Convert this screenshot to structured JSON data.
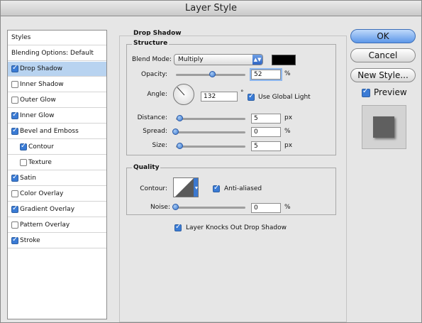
{
  "window": {
    "title": "Layer Style"
  },
  "sidebar": {
    "header": "Styles",
    "blending": "Blending Options: Default",
    "items": [
      {
        "label": "Drop Shadow",
        "checked": true,
        "selected": true,
        "indent": false
      },
      {
        "label": "Inner Shadow",
        "checked": false,
        "selected": false,
        "indent": false
      },
      {
        "label": "Outer Glow",
        "checked": false,
        "selected": false,
        "indent": false
      },
      {
        "label": "Inner Glow",
        "checked": true,
        "selected": false,
        "indent": false
      },
      {
        "label": "Bevel and Emboss",
        "checked": true,
        "selected": false,
        "indent": false
      },
      {
        "label": "Contour",
        "checked": true,
        "selected": false,
        "indent": true
      },
      {
        "label": "Texture",
        "checked": false,
        "selected": false,
        "indent": true
      },
      {
        "label": "Satin",
        "checked": true,
        "selected": false,
        "indent": false
      },
      {
        "label": "Color Overlay",
        "checked": false,
        "selected": false,
        "indent": false
      },
      {
        "label": "Gradient Overlay",
        "checked": true,
        "selected": false,
        "indent": false
      },
      {
        "label": "Pattern Overlay",
        "checked": false,
        "selected": false,
        "indent": false
      },
      {
        "label": "Stroke",
        "checked": true,
        "selected": false,
        "indent": false
      }
    ]
  },
  "drop_shadow": {
    "title": "Drop Shadow",
    "structure": {
      "title": "Structure",
      "blend_mode_label": "Blend Mode:",
      "blend_mode_value": "Multiply",
      "shadow_color": "#000000",
      "opacity_label": "Opacity:",
      "opacity_value": "52",
      "opacity_unit": "%",
      "opacity_fraction": 0.52,
      "angle_label": "Angle:",
      "angle_value": "132",
      "angle_unit": "°",
      "use_global_light_label": "Use Global Light",
      "use_global_light": true,
      "distance_label": "Distance:",
      "distance_value": "5",
      "distance_unit": "px",
      "spread_label": "Spread:",
      "spread_value": "0",
      "spread_unit": "%",
      "size_label": "Size:",
      "size_value": "5",
      "size_unit": "px"
    },
    "quality": {
      "title": "Quality",
      "contour_label": "Contour:",
      "anti_aliased_label": "Anti-aliased",
      "anti_aliased": true,
      "noise_label": "Noise:",
      "noise_value": "0",
      "noise_unit": "%"
    },
    "knocks_out_label": "Layer Knocks Out Drop Shadow",
    "knocks_out": true
  },
  "buttons": {
    "ok": "OK",
    "cancel": "Cancel",
    "new_style": "New Style...",
    "preview_label": "Preview",
    "preview_checked": true
  },
  "colors": {
    "accent": "#3a7bd5",
    "selection": "#b8d3f0"
  }
}
